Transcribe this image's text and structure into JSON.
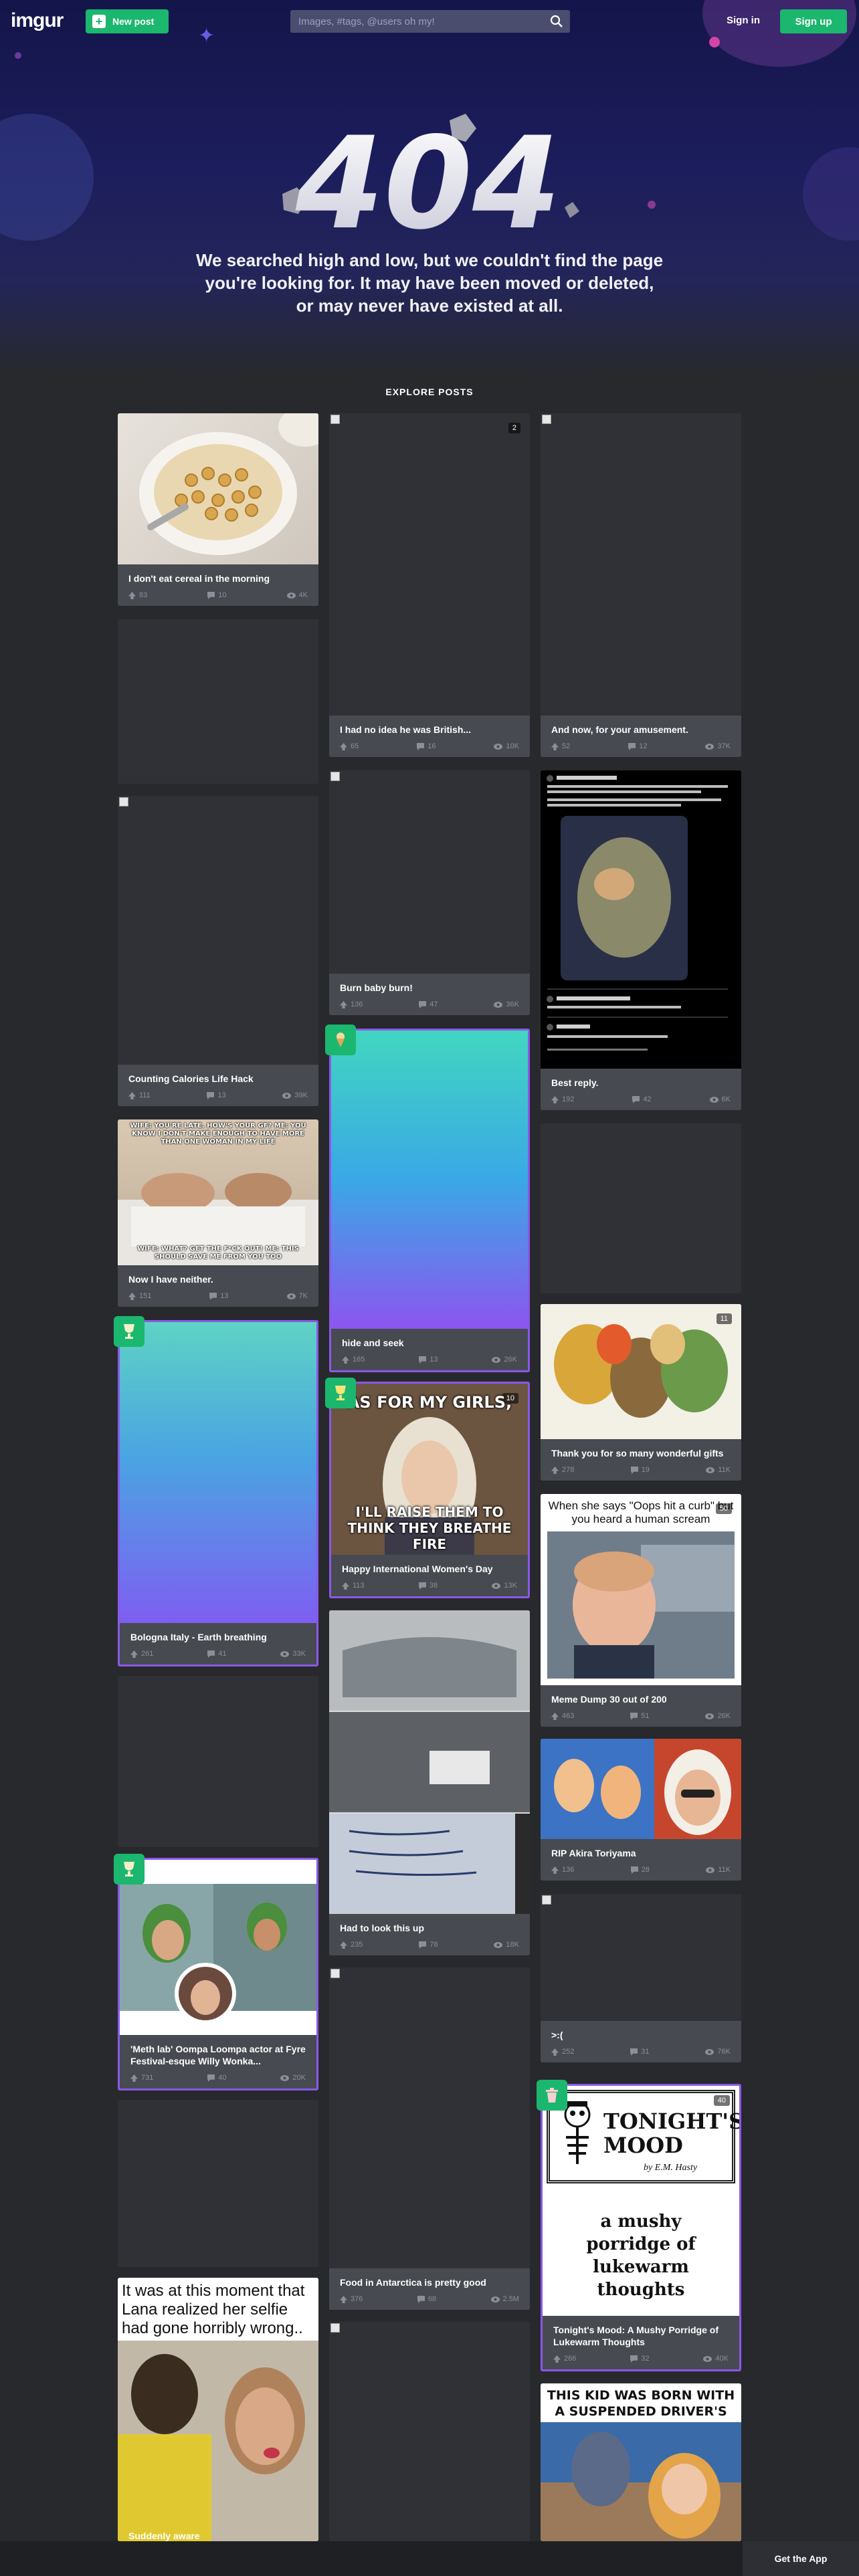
{
  "header": {
    "logo": "imgur",
    "new_post_label": "New post",
    "search_placeholder": "Images, #tags, @users oh my!",
    "sign_in_label": "Sign in",
    "sign_up_label": "Sign up"
  },
  "error": {
    "code": "404",
    "message": "We searched high and low, but we couldn't find the page you're looking for. It may have been moved or deleted, or may never have existed at all."
  },
  "explore": {
    "title": "EXPLORE POSTS",
    "posts": [
      {
        "title": "I don't eat cereal in the morning",
        "upvotes": "83",
        "comments": "10",
        "views": "4K"
      },
      {
        "title": "",
        "upvotes": "",
        "comments": "",
        "views": ""
      },
      {
        "title": "Counting Calories Life Hack",
        "upvotes": "111",
        "comments": "13",
        "views": "39K"
      },
      {
        "title": "Now I have neither.",
        "upvotes": "151",
        "comments": "13",
        "views": "7K",
        "caption_top": "WIFE: YOU'RE LATE. HOW'S YOUR GF? ME: YOU KNOW I DON'T MAKE ENOUGH TO HAVE MORE THAN ONE WOMAN IN MY LIFE",
        "caption_bottom": "WIFE: WHAT? GET THE F*CK OUT! ME: THIS SHOULD SAVE ME FROM YOU TOO"
      },
      {
        "title": "Bologna Italy - Earth breathing",
        "upvotes": "261",
        "comments": "41",
        "views": "33K"
      },
      {
        "title": "",
        "upvotes": "",
        "comments": "",
        "views": ""
      },
      {
        "title": "'Meth lab' Oompa Loompa actor at Fyre Festival-esque Willy Wonka...",
        "upvotes": "731",
        "comments": "40",
        "views": "20K"
      },
      {
        "title": "",
        "upvotes": "",
        "comments": "",
        "views": ""
      },
      {
        "title": "Suddenly aware",
        "upvotes": "",
        "comments": "",
        "views": "",
        "caption": "It was at this moment that Lana realized her selfie had gone horribly wrong.."
      },
      {
        "title": "I had no idea he was British...",
        "upvotes": "65",
        "comments": "16",
        "views": "10K",
        "count": "2"
      },
      {
        "title": "Burn baby burn!",
        "upvotes": "136",
        "comments": "47",
        "views": "36K"
      },
      {
        "title": "hide and seek",
        "upvotes": "165",
        "comments": "13",
        "views": "26K"
      },
      {
        "title": "Happy International Women's Day",
        "upvotes": "113",
        "comments": "38",
        "views": "13K",
        "count": "10",
        "caption_top": "AS FOR MY GIRLS,",
        "caption_bottom": "I'LL RAISE THEM TO THINK THEY BREATHE FIRE"
      },
      {
        "title": "Had to look this up",
        "upvotes": "235",
        "comments": "78",
        "views": "18K"
      },
      {
        "title": "Food in Antarctica is pretty good",
        "upvotes": "376",
        "comments": "68",
        "views": "2.5M"
      },
      {
        "title": "",
        "upvotes": "",
        "comments": "",
        "views": ""
      },
      {
        "title": "And now, for your amusement.",
        "upvotes": "52",
        "comments": "12",
        "views": "37K"
      },
      {
        "title": "Best reply.",
        "upvotes": "192",
        "comments": "42",
        "views": "6K"
      },
      {
        "title": "",
        "upvotes": "",
        "comments": "",
        "views": ""
      },
      {
        "title": "Thank you for so many wonderful gifts",
        "upvotes": "278",
        "comments": "19",
        "views": "11K",
        "count": "11"
      },
      {
        "title": "Meme Dump 30 out of 200",
        "upvotes": "463",
        "comments": "51",
        "views": "26K",
        "count": "50",
        "caption": "When she says \"Oops hit a curb\" but you heard a human scream"
      },
      {
        "title": "RIP Akira Toriyama",
        "upvotes": "136",
        "comments": "28",
        "views": "11K"
      },
      {
        "title": ">:(",
        "upvotes": "252",
        "comments": "31",
        "views": "76K"
      },
      {
        "title": "Tonight's Mood: A Mushy Porridge of Lukewarm Thoughts",
        "upvotes": "266",
        "comments": "32",
        "views": "40K",
        "count": "40",
        "poster_title": "TONIGHT'S MOOD",
        "poster_author": "by E.M. Hasty",
        "poster_text": "a mushy porridge of lukewarm thoughts"
      },
      {
        "title": "",
        "upvotes": "",
        "comments": "",
        "views": "",
        "caption": "THIS KID WAS BORN WITH A SUSPENDED DRIVER'S LICENSE"
      }
    ]
  },
  "footer": {
    "get_app_label": "Get the App"
  },
  "colors": {
    "accent_green": "#1bb76e",
    "card_bg": "#474a51",
    "page_bg": "#27292d",
    "promo_border": "#8a58e8"
  }
}
